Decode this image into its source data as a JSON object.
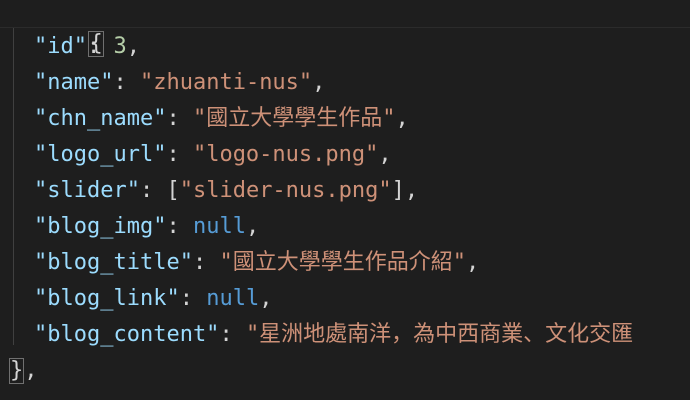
{
  "editor": {
    "lines": [
      {
        "open_brace": "{"
      },
      {
        "key": "\"id\"",
        "colon": ": ",
        "value": "3",
        "value_type": "number",
        "tail": ","
      },
      {
        "key": "\"name\"",
        "colon": ": ",
        "value": "\"zhuanti-nus\"",
        "value_type": "string",
        "tail": ","
      },
      {
        "key": "\"chn_name\"",
        "colon": ": ",
        "value": "\"國立大學學生作品\"",
        "value_type": "string",
        "tail": ","
      },
      {
        "key": "\"logo_url\"",
        "colon": ": ",
        "value": "\"logo-nus.png\"",
        "value_type": "string",
        "tail": ","
      },
      {
        "key": "\"slider\"",
        "colon": ": ",
        "bracket_open": "[",
        "value": "\"slider-nus.png\"",
        "bracket_close": "]",
        "tail": ","
      },
      {
        "key": "\"blog_img\"",
        "colon": ": ",
        "value": "null",
        "value_type": "keyword",
        "tail": ","
      },
      {
        "key": "\"blog_title\"",
        "colon": ": ",
        "value": "\"國立大學學生作品介紹\"",
        "value_type": "string",
        "tail": ","
      },
      {
        "key": "\"blog_link\"",
        "colon": ": ",
        "value": "null",
        "value_type": "keyword",
        "tail": ","
      },
      {
        "key": "\"blog_content\"",
        "colon": ": ",
        "value": "\"星洲地處南洋，為中西商業、文化交匯",
        "value_type": "string"
      },
      {
        "close_brace": "}",
        "tail": ","
      }
    ],
    "colors": {
      "background": "#1e1e1e",
      "key": "#9cdcfe",
      "string": "#ce9178",
      "number": "#b5cea8",
      "keyword": "#569cd6",
      "punctuation": "#d4d4d4"
    }
  }
}
